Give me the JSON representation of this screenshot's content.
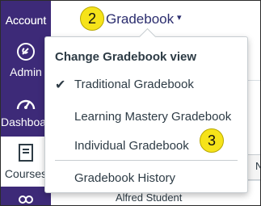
{
  "nav": {
    "items": [
      {
        "label": "Account",
        "icon": "account-icon"
      },
      {
        "label": "Admin",
        "icon": "admin-shield-icon"
      },
      {
        "label": "Dashboard",
        "icon": "dashboard-gauge-icon"
      },
      {
        "label": "Courses",
        "icon": "courses-book-icon"
      },
      {
        "label": "",
        "icon": "groups-icon"
      }
    ],
    "background": "#3d2a78"
  },
  "header": {
    "title": "Gradebook",
    "caret": "▾"
  },
  "badges": {
    "step_two": "2",
    "step_three": "3"
  },
  "menu": {
    "heading": "Change Gradebook view",
    "items": [
      {
        "label": "Traditional Gradebook",
        "selected": true,
        "check": "✔"
      },
      {
        "label": "Learning Mastery Gradebook"
      },
      {
        "label": "Individual Gradebook"
      },
      {
        "label": "Gradebook History"
      }
    ]
  },
  "grid": {
    "student": "Alfred Student",
    "column_letter": "N"
  },
  "colors": {
    "accent": "#2b2d6e",
    "badge": "#f6e31a"
  }
}
